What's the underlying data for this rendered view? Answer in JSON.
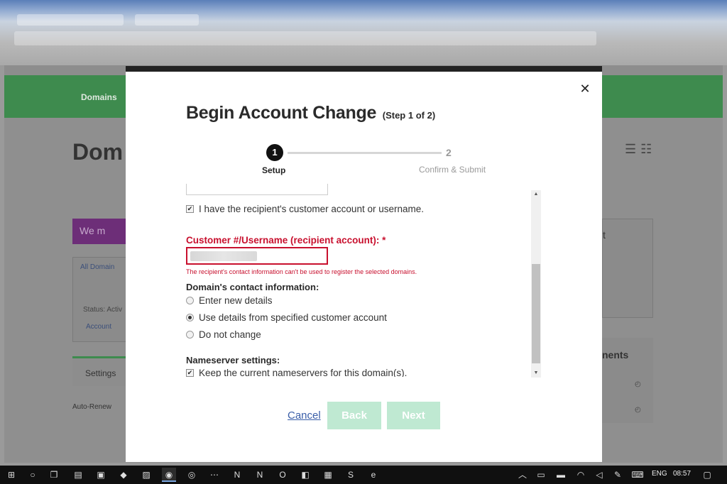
{
  "background": {
    "nav_label": "Domains",
    "page_title": "Dom",
    "banner_text": "We m",
    "card_link": "All Domain",
    "card_status": "Status: Activ",
    "card_account": "Account",
    "settings_tab": "Settings",
    "auto_renew": "Auto-Renew",
    "right_card_title": "t",
    "right_card2_title": "nents"
  },
  "modal": {
    "close_glyph": "✕",
    "title": "Begin Account Change",
    "step_note": "(Step 1 of 2)",
    "steps": [
      {
        "number": "1",
        "label": "Setup"
      },
      {
        "number": "2",
        "label": "Confirm & Submit"
      }
    ],
    "have_account_label": "I have the recipient's customer account or username.",
    "customer_field": {
      "label": "Customer #/Username (recipient account): *",
      "error": "The recipient's contact information can't be used to register the selected domains."
    },
    "contact_section": {
      "label": "Domain's contact information:",
      "options": [
        {
          "label": "Enter new details",
          "selected": false
        },
        {
          "label": "Use details from specified customer account",
          "selected": true
        },
        {
          "label": "Do not change",
          "selected": false
        }
      ]
    },
    "nameserver_section": {
      "label": "Nameserver settings:",
      "keep_label": "Keep the current nameservers for this domain(s)."
    },
    "buttons": {
      "cancel": "Cancel",
      "back": "Back",
      "next": "Next"
    }
  },
  "taskbar": {
    "language": "ENG",
    "time": "08:57"
  },
  "colors": {
    "error_red": "#c8102e",
    "button_disabled": "#bfe9d2",
    "link_blue": "#3a5ea8"
  }
}
